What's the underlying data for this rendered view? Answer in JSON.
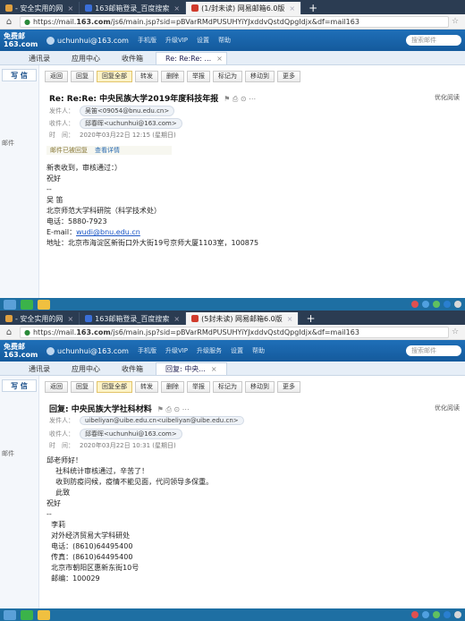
{
  "panels": [
    {
      "tabs": [
        {
          "label": "- 安全实用的网",
          "color": "#e0a040"
        },
        {
          "label": "163邮箱登录_百度搜索",
          "color": "#3a6fd8"
        },
        {
          "label": "(1/封未读) 网易邮箱6.0版",
          "color": "#d03b2c"
        }
      ],
      "url": {
        "prefix": "https://mail.",
        "domain": "163.com",
        "suffix": "/js6/main.jsp?sid=pBVarRMdPUSUHYiYJxddvQstdQpgIdjx&df=mail163"
      },
      "header": {
        "logo1": "免费邮",
        "logo2": "163.com",
        "user": "uchunhui@163.com",
        "links": [
          "手机版",
          "升级VIP",
          "设置",
          "帮助"
        ],
        "search_placeholder": "搜索邮件"
      },
      "nav_tabs": [
        "通讯录",
        "应用中心",
        "收件箱"
      ],
      "active_tab": "Re: Re:Re: ...",
      "sidebar": {
        "write": "写 信",
        "folder": "邮件"
      },
      "toolbar": [
        "返回",
        "回复",
        "回复全部",
        "转发",
        "删除",
        "举报",
        "标记为",
        "移动到",
        "更多"
      ],
      "subject": "Re: Re:Re: 中央民族大学2019年度科技年报",
      "right_opt": "优化阅读",
      "from_label": "发件人：",
      "from": "吴笛<09054@bnu.edu.cn>",
      "to_label": "收件人：",
      "to": "邱春晖<uchunhui@163.com>",
      "time_label": "时　间：",
      "time": "2020年03月22日 12:15 (星期日)",
      "notice": "邮件已被回复",
      "notice_link": "查看详情",
      "body": {
        "lines": [
          "新表收到，审核通过：）",
          "祝好",
          "",
          "",
          "--",
          "吴 笛",
          "北京师范大学科研院（科学技术处）",
          "电话：5880-7923"
        ],
        "email_label": "E-mail：",
        "email": "wudi@bnu.edu.cn",
        "address": "地址：北京市海淀区新街口外大街19号京师大厦1103室，100875"
      }
    },
    {
      "tabs": [
        {
          "label": "- 安全实用的网",
          "color": "#e0a040"
        },
        {
          "label": "163邮箱登录_百度搜索",
          "color": "#3a6fd8"
        },
        {
          "label": "(5封未读) 网易邮箱6.0版",
          "color": "#d03b2c"
        }
      ],
      "url": {
        "prefix": "https://mail.",
        "domain": "163.com",
        "suffix": "/js6/main.jsp?sid=pBVarRMdPUSUHYiYJxddvQstdQpgIdjx&df=mail163"
      },
      "header": {
        "logo1": "免费邮",
        "logo2": "163.com",
        "user": "uchunhui@163.com",
        "links": [
          "手机版",
          "升级VIP",
          "升级服务",
          "设置",
          "帮助"
        ],
        "search_placeholder": "搜索邮件"
      },
      "nav_tabs": [
        "通讯录",
        "应用中心",
        "收件箱"
      ],
      "active_tab": "回复: 中央...",
      "sidebar": {
        "write": "写 信",
        "folder": "邮件"
      },
      "toolbar": [
        "返回",
        "回复",
        "回复全部",
        "转发",
        "删除",
        "举报",
        "标记为",
        "移动到",
        "更多"
      ],
      "subject": "回复: 中央民族大学社科材料",
      "right_opt": "优化阅读",
      "from_label": "发件人：",
      "from": "uibeliyan@uibe.edu.cn<uibeliyan@uibe.edu.cn>",
      "to_label": "收件人：",
      "to": "邱春晖<uchunhui@163.com>",
      "time_label": "时　间：",
      "time": "2020年03月22日 10:31 (星期日)",
      "body": {
        "lines": [
          "邱老师好！",
          "    社科统计审核通过，辛苦了！",
          "    收到防疫问候，疫情不能见面，代问领导多保重。",
          "    此致",
          "祝好",
          "",
          "--",
          "  李莉",
          "  对外经济贸易大学科研处",
          "  电话：(8610)64495400",
          "  传真：(8610)64495400",
          "  北京市朝阳区惠新东街10号",
          "  邮编：100029"
        ]
      }
    }
  ]
}
